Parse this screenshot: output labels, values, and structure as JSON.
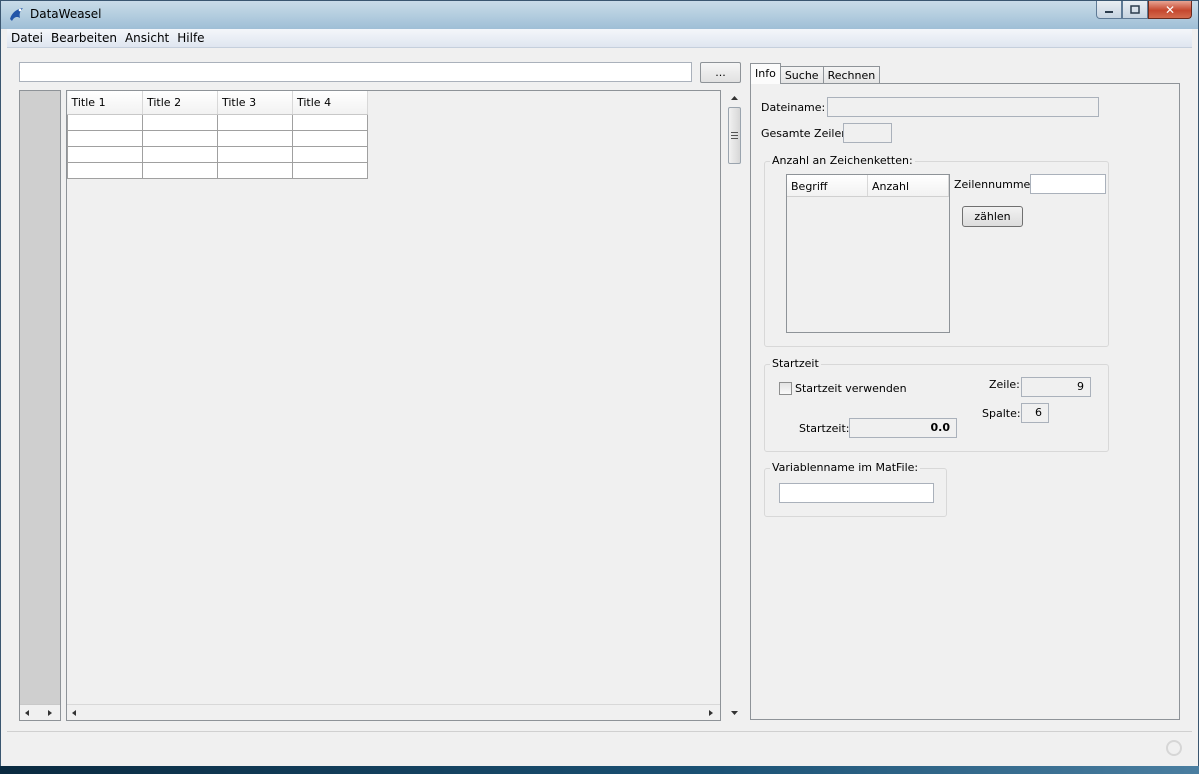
{
  "window": {
    "title": "DataWeasel",
    "close_glyph": "✕"
  },
  "menu": [
    "Datei",
    "Bearbeiten",
    "Ansicht",
    "Hilfe"
  ],
  "browse_button": "...",
  "grid": {
    "columns": [
      "Title 1",
      "Title 2",
      "Title 3",
      "Title 4"
    ],
    "rows": 4
  },
  "tabs": [
    "Info",
    "Suche",
    "Rechnen"
  ],
  "info": {
    "dateiname_label": "Dateiname:",
    "dateiname_value": "",
    "gesamte_zeilen_label": "Gesamte Zeilen:",
    "gesamte_zeilen_value": "",
    "anzahl_group": "Anzahl an Zeichenketten:",
    "list_columns": [
      "Begriff",
      "Anzahl"
    ],
    "zeilennummer_label": "Zeilennummer:",
    "zeilennummer_value": "",
    "zaehlen_button": "zählen",
    "startzeit_group": "Startzeit",
    "startzeit_checkbox": "Startzeit verwenden",
    "startzeit_checked": false,
    "zeile_label": "Zeile:",
    "zeile_value": "9",
    "spalte_label": "Spalte:",
    "spalte_value": "6",
    "startzeit_label": "Startzeit:",
    "startzeit_value": "0.0",
    "variablenname_group": "Variablenname im MatFile:",
    "variablenname_value": ""
  }
}
